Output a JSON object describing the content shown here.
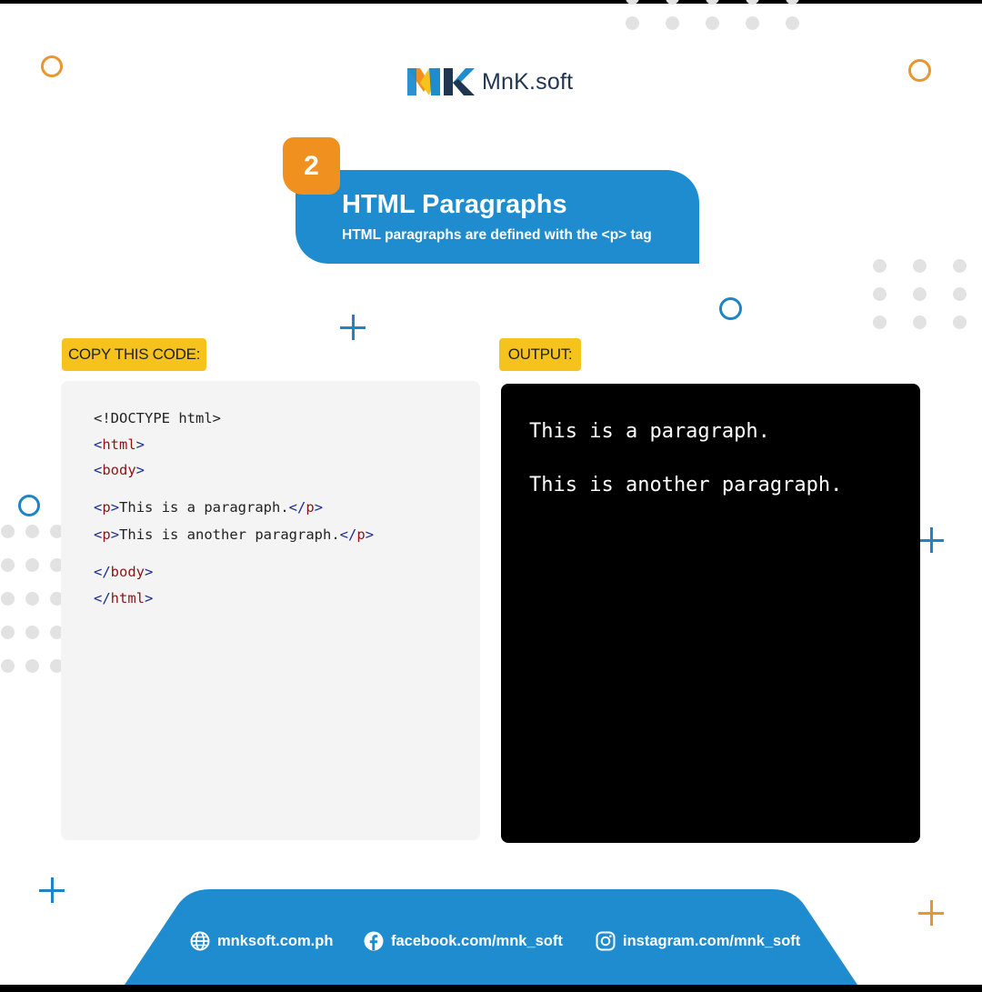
{
  "brand": {
    "name": "MnK.soft",
    "colors": {
      "blue": "#1f8ccf",
      "orange": "#f0901f",
      "yellow": "#f6c21c",
      "navy": "#1f3550"
    }
  },
  "banner": {
    "number": "2",
    "title": "HTML Paragraphs",
    "subtitle": "HTML paragraphs are defined with the <p> tag"
  },
  "labels": {
    "code": "COPY THIS CODE:",
    "output": "OUTPUT:"
  },
  "code": {
    "doctype": "<!DOCTYPE html>",
    "open_html": "html",
    "open_body": "body",
    "p_tag": "p",
    "p1_text": "This is a paragraph.",
    "p2_text": "This is another paragraph.",
    "close_body": "body",
    "close_html": "html"
  },
  "output": {
    "lines": [
      "This is a paragraph.",
      "This is another paragraph."
    ]
  },
  "footer": {
    "website": "mnksoft.com.ph",
    "facebook": "facebook.com/mnk_soft",
    "instagram": "instagram.com/mnk_soft",
    "icons": [
      "globe-icon",
      "facebook-icon",
      "instagram-icon"
    ]
  }
}
